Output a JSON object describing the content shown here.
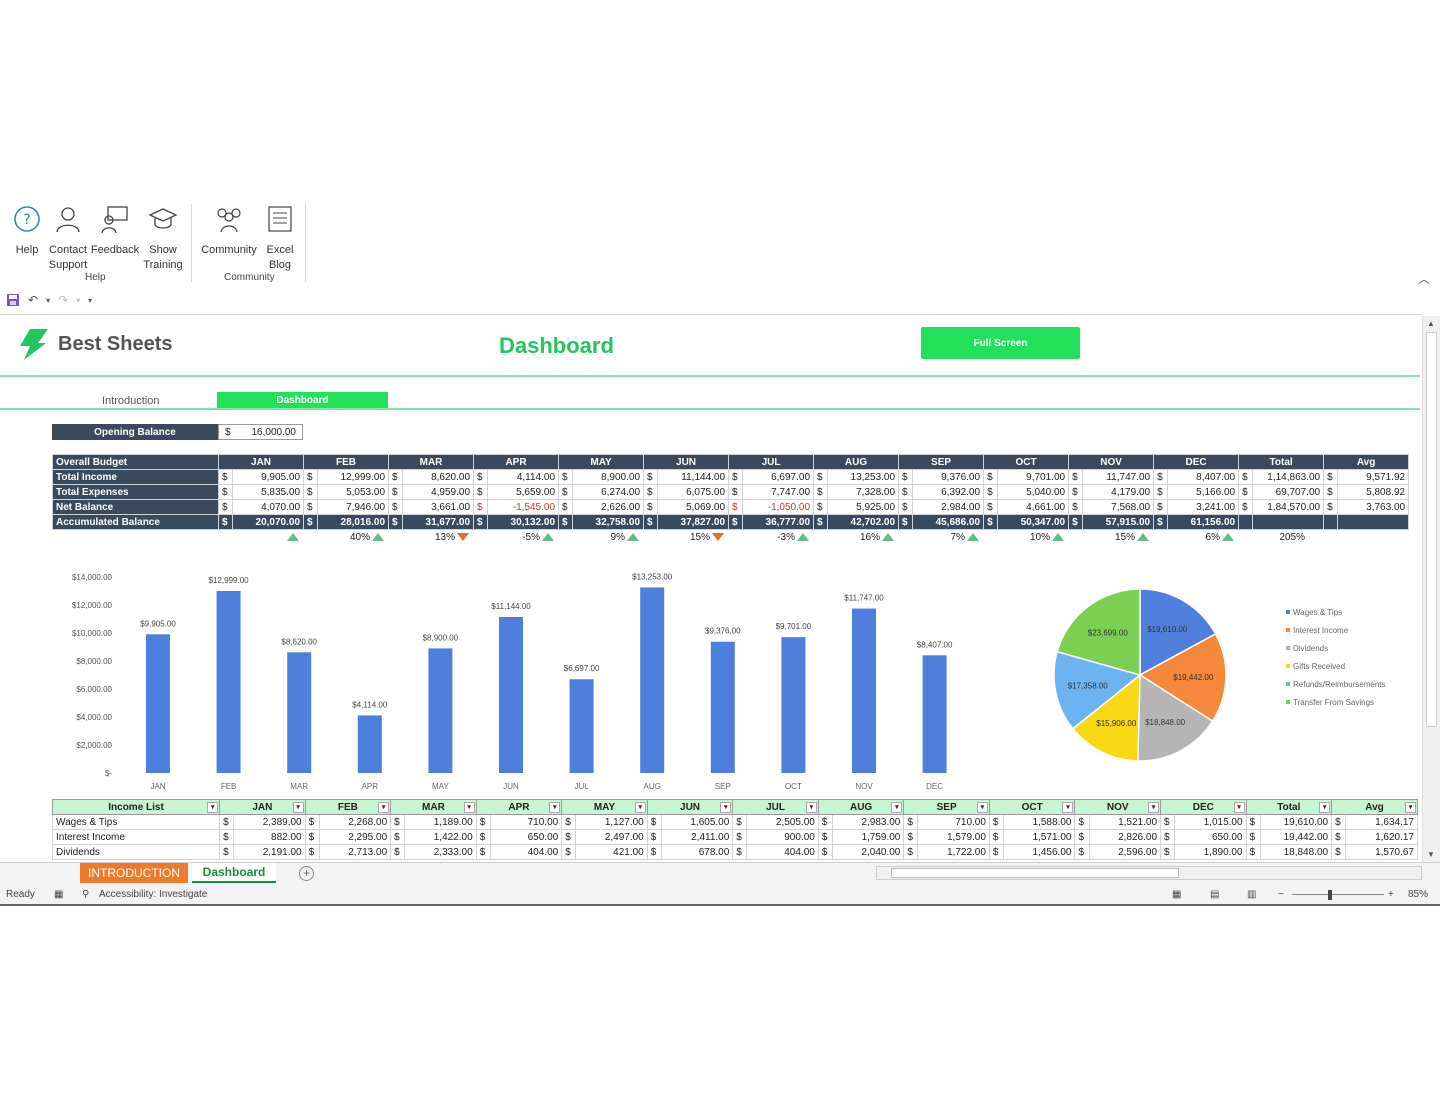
{
  "ribbon": {
    "help_group": {
      "label": "Help",
      "buttons": [
        {
          "label1": "Help",
          "label2": "",
          "icon": "help-icon"
        },
        {
          "label1": "Contact",
          "label2": "Support",
          "icon": "contact-icon"
        },
        {
          "label1": "Feedback",
          "label2": "",
          "icon": "feedback-icon"
        },
        {
          "label1": "Show",
          "label2": "Training",
          "icon": "training-icon"
        }
      ]
    },
    "community_group": {
      "label": "Community",
      "buttons": [
        {
          "label1": "Community",
          "label2": "",
          "icon": "community-icon"
        },
        {
          "label1": "Excel",
          "label2": "Blog",
          "icon": "blog-icon"
        }
      ]
    }
  },
  "header": {
    "logo_text": "Best Sheets",
    "title": "Dashboard",
    "full_screen": "Full Screen",
    "nav_intro": "Introduction",
    "nav_dashboard": "Dashboard",
    "colors": {
      "accent": "#22e05a",
      "header_dark": "#3a4a5e",
      "orange": "#f07a2c"
    }
  },
  "opening_balance": {
    "label": "Opening  Balance",
    "currency": "$",
    "value": "16,000.00"
  },
  "budget_table": {
    "columns": [
      "Overall Budget",
      "JAN",
      "FEB",
      "MAR",
      "APR",
      "MAY",
      "JUN",
      "JUL",
      "AUG",
      "SEP",
      "OCT",
      "NOV",
      "DEC",
      "Total",
      "Avg"
    ],
    "rows": [
      {
        "label": "Total Income",
        "values": [
          "9,905.00",
          "12,999.00",
          "8,620.00",
          "4,114.00",
          "8,900.00",
          "11,144.00",
          "6,697.00",
          "13,253.00",
          "9,376.00",
          "9,701.00",
          "11,747.00",
          "8,407.00",
          "1,14,863.00",
          "9,571.92"
        ]
      },
      {
        "label": "Total Expenses",
        "values": [
          "5,835.00",
          "5,053.00",
          "4,959.00",
          "5,659.00",
          "6,274.00",
          "6,075.00",
          "7,747.00",
          "7,328.00",
          "6,392.00",
          "5,040.00",
          "4,179.00",
          "5,166.00",
          "69,707.00",
          "5,808.92"
        ]
      },
      {
        "label": "Net Balance",
        "values": [
          "4,070.00",
          "7,946.00",
          "3,661.00",
          "-1,545.00",
          "2,626.00",
          "5,069.00",
          "-1,050.00",
          "5,925.00",
          "2,984.00",
          "4,661.00",
          "7,568.00",
          "3,241.00",
          "1,84,570.00",
          "3,763.00"
        ]
      },
      {
        "label": "Accumulated Balance",
        "values": [
          "20,070.00",
          "28,016.00",
          "31,677.00",
          "30,132.00",
          "32,758.00",
          "37,827.00",
          "36,777.00",
          "42,702.00",
          "45,686.00",
          "50,347.00",
          "57,915.00",
          "61,156.00",
          "",
          ""
        ]
      }
    ],
    "growth": [
      {
        "pct": "",
        "dir": "up"
      },
      {
        "pct": "40%",
        "dir": "up"
      },
      {
        "pct": "13%",
        "dir": "down"
      },
      {
        "pct": "-5%",
        "dir": "up"
      },
      {
        "pct": "9%",
        "dir": "up"
      },
      {
        "pct": "15%",
        "dir": "down"
      },
      {
        "pct": "-3%",
        "dir": "up"
      },
      {
        "pct": "16%",
        "dir": "up"
      },
      {
        "pct": "7%",
        "dir": "up"
      },
      {
        "pct": "10%",
        "dir": "up"
      },
      {
        "pct": "15%",
        "dir": "up"
      },
      {
        "pct": "6%",
        "dir": "up"
      },
      {
        "pct": "205%",
        "dir": ""
      }
    ]
  },
  "chart_data": [
    {
      "type": "bar",
      "categories": [
        "JAN",
        "FEB",
        "MAR",
        "APR",
        "MAY",
        "JUN",
        "JUL",
        "AUG",
        "SEP",
        "OCT",
        "NOV",
        "DEC"
      ],
      "values": [
        9905,
        12999,
        8620,
        4114,
        8900,
        11144,
        6697,
        13253,
        9376,
        9701,
        11747,
        8407
      ],
      "labels": [
        "$9,905.00",
        "$12,999.00",
        "$8,620.00",
        "$4,114.00",
        "$8,900.00",
        "$11,144.00",
        "$6,697.00",
        "$13,253.00",
        "$9,376.00",
        "$9,701.00",
        "$11,747.00",
        "$8,407.00"
      ],
      "yticks": [
        "$14,000.00",
        "$12,000.00",
        "$10,000.00",
        "$8,000.00",
        "$6,000.00",
        "$4,000.00",
        "$2,000.00",
        "$-"
      ],
      "ylim": [
        0,
        14000
      ],
      "color": "#4f7fdc"
    },
    {
      "type": "pie",
      "slices": [
        {
          "name": "Wages & Tips",
          "value": 19610,
          "label": "$19,610.00",
          "color": "#4f7fdc"
        },
        {
          "name": "Interest Income",
          "value": 19442,
          "label": "$19,442.00",
          "color": "#f5883a"
        },
        {
          "name": "Dividends",
          "value": 18848,
          "label": "$18,848.00",
          "color": "#b5b5b5"
        },
        {
          "name": "Gifts Received",
          "value": 15906,
          "label": "$15,906.00",
          "color": "#f7d812"
        },
        {
          "name": "Refunds/Reimbursements",
          "value": 17358,
          "label": "$17,358.00",
          "color": "#6cb4f0"
        },
        {
          "name": "Transfer From Savings",
          "value": 23699,
          "label": "$23,699.00",
          "color": "#7ccf52"
        }
      ],
      "legend_position": "right"
    }
  ],
  "income_table": {
    "columns": [
      "Income List",
      "JAN",
      "FEB",
      "MAR",
      "APR",
      "MAY",
      "JUN",
      "JUL",
      "AUG",
      "SEP",
      "OCT",
      "NOV",
      "DEC",
      "Total",
      "Avg"
    ],
    "rows": [
      {
        "label": "Wages & Tips",
        "values": [
          "2,389.00",
          "2,268.00",
          "1,189.00",
          "710.00",
          "1,127.00",
          "1,605.00",
          "2,505.00",
          "2,983.00",
          "710.00",
          "1,588.00",
          "1,521.00",
          "1,015.00",
          "19,610.00",
          "1,634.17"
        ]
      },
      {
        "label": "Interest Income",
        "values": [
          "882.00",
          "2,295.00",
          "1,422.00",
          "650.00",
          "2,497.00",
          "2,411.00",
          "900.00",
          "1,759.00",
          "1,579.00",
          "1,571.00",
          "2,826.00",
          "650.00",
          "19,442.00",
          "1,620.17"
        ]
      },
      {
        "label": "Dividends",
        "values": [
          "2,191.00",
          "2,713.00",
          "2,333.00",
          "404.00",
          "421.00",
          "678.00",
          "404.00",
          "2,040.00",
          "1,722.00",
          "1,456.00",
          "2,596.00",
          "1,890.00",
          "18,848.00",
          "1,570.67"
        ]
      }
    ]
  },
  "tabs": {
    "intro": "INTRODUCTION",
    "dashboard": "Dashboard"
  },
  "status": {
    "ready": "Ready",
    "accessibility": "Accessibility: Investigate",
    "zoom": "85%"
  }
}
